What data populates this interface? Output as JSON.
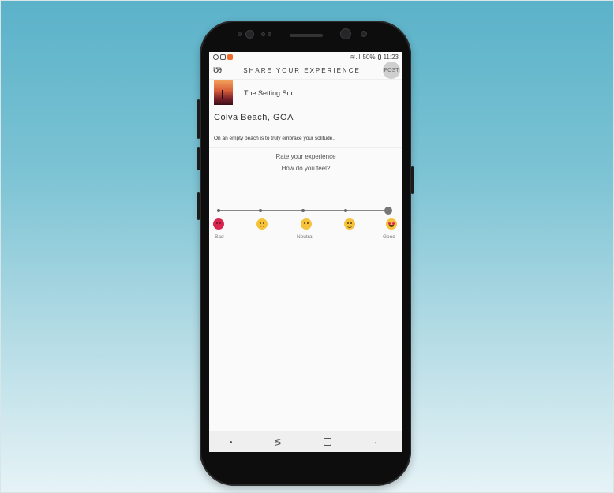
{
  "status": {
    "battery": "50%",
    "time": "11:23"
  },
  "header": {
    "logo": "Ʊθ",
    "title": "SHARE YOUR EXPERIENCE",
    "post_label": "POST"
  },
  "place": {
    "name": "The Setting Sun"
  },
  "location": {
    "name": "Colva Beach, GOA"
  },
  "caption": {
    "text": "On an empty beach is to truly embrace your solitude.."
  },
  "rating": {
    "heading": "Rate your experience",
    "question": "How do you feel?",
    "selected_level": 5,
    "levels": 5,
    "labels": {
      "bad": "Bad",
      "neutral": "Neutral",
      "good": "Good"
    }
  },
  "nav": {
    "recent": "≶",
    "back": "←"
  },
  "colors": {
    "bad_emoji": "#d8264f",
    "emoji_yellow": "#f5c33b",
    "post_button": "#cfcfcf"
  }
}
